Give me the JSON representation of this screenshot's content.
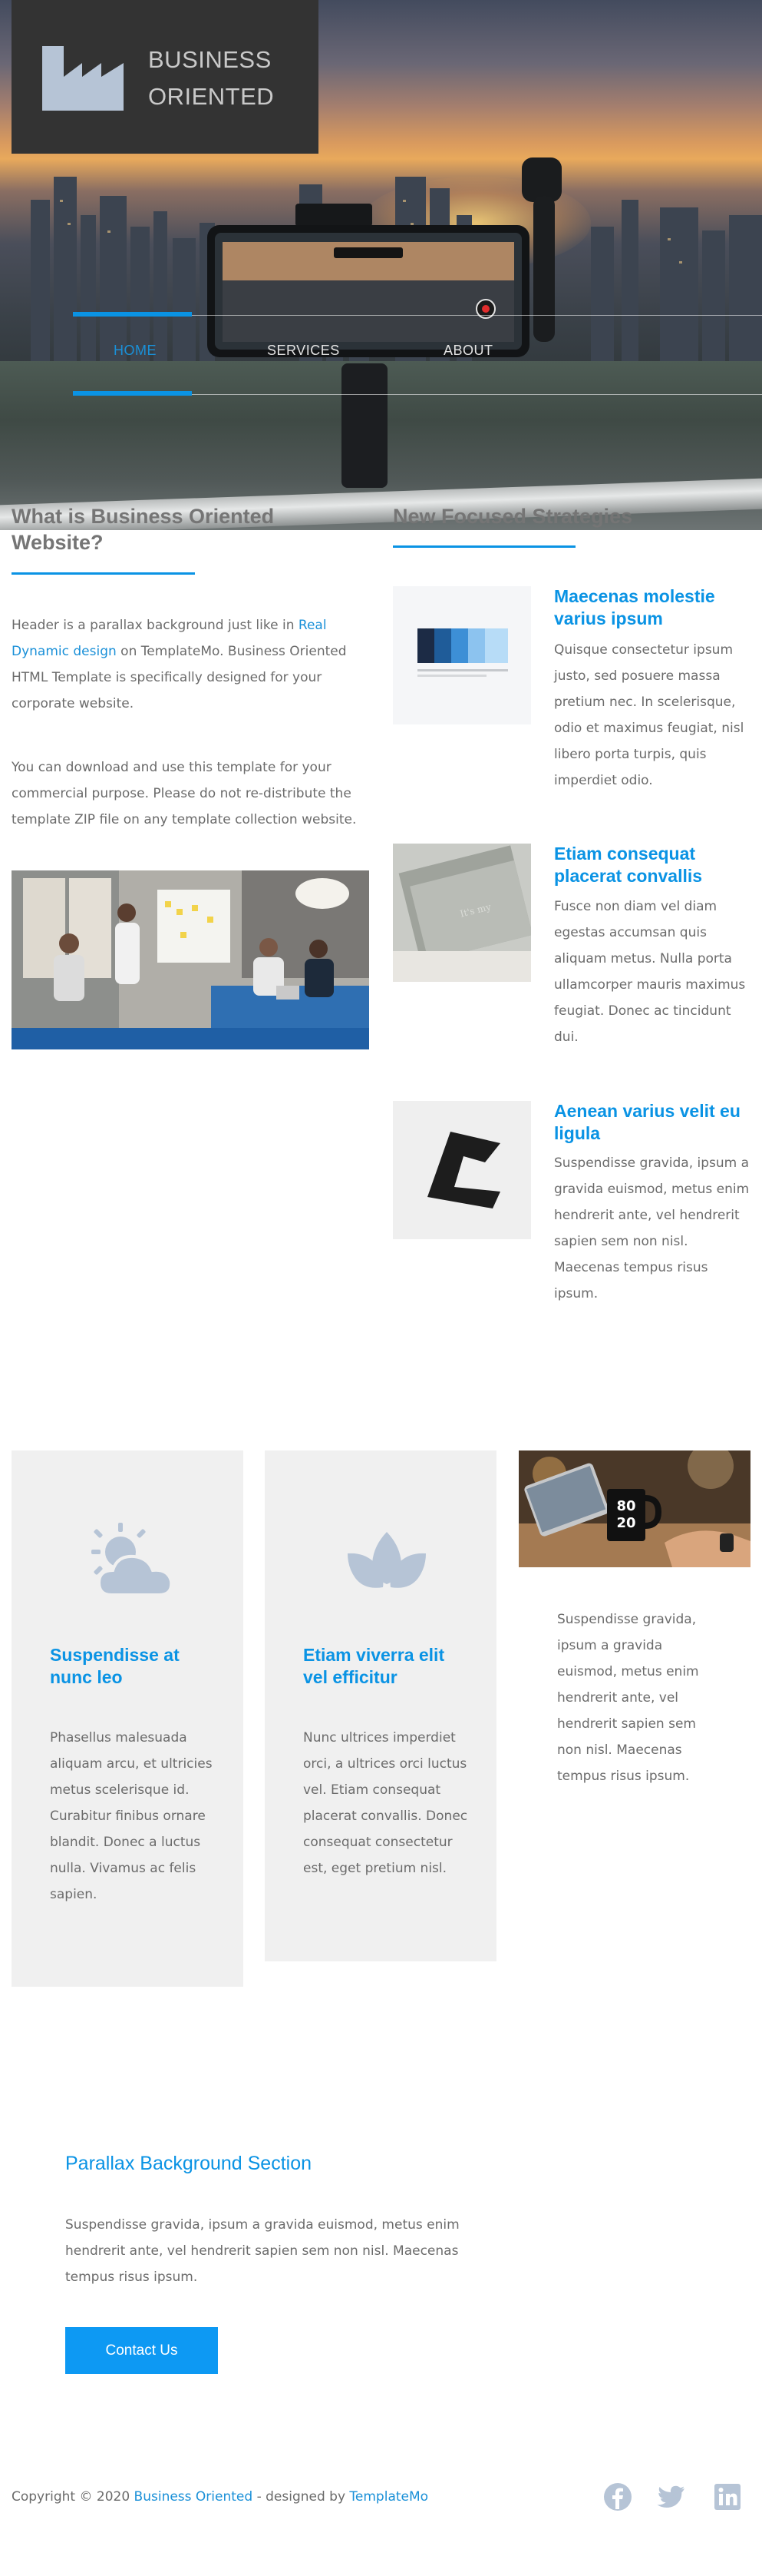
{
  "brand": {
    "name_line1": "BUSINESS",
    "name_line2": "ORIENTED"
  },
  "nav": {
    "items": [
      {
        "label": "HOME"
      },
      {
        "label": "SERVICES"
      },
      {
        "label": "ABOUT"
      }
    ]
  },
  "about": {
    "title": "What is Business Oriented Website?",
    "para1_before": "Header is a parallax background just like in ",
    "para1_link": "Real Dynamic design",
    "para1_after": " on TemplateMo. Business Oriented HTML Template is specifically designed for your corporate website.",
    "para2": "You can download and use this template for your commercial purpose. Please do not re-distribute the template ZIP file on any template collection website."
  },
  "strategies": {
    "title": "New Focused Strategies",
    "items": [
      {
        "title": "Maecenas molestie varius ipsum",
        "text": "Quisque consectetur ipsum justo, sed posuere massa pretium nec. In scelerisque, odio et maximus feugiat, nisl libero porta turpis, quis imperdiet odio."
      },
      {
        "title": "Etiam consequat placerat convallis",
        "text": "Fusce non diam vel diam egestas accumsan quis aliquam metus. Nulla porta ullamcorper mauris maximus feugiat. Donec ac tincidunt dui."
      },
      {
        "title": "Aenean varius velit eu ligula",
        "text": "Suspendisse gravida, ipsum a gravida euismod, metus enim hendrerit ante, vel hendrerit sapien sem non nisl. Maecenas tempus risus ipsum."
      }
    ],
    "thumb_text": "It's my"
  },
  "features": {
    "cards": [
      {
        "icon": "sun-cloud-icon",
        "title": "Suspendisse at nunc leo",
        "text": "Phasellus malesuada aliquam arcu, et ultricies metus scelerisque id. Curabitur finibus ornare blandit. Donec a luctus nulla. Vivamus ac felis sapien."
      },
      {
        "icon": "lotus-icon",
        "title": "Etiam viverra elit vel efficitur",
        "text": "Nunc ultrices imperdiet orci, a ultrices orci luctus vel. Etiam consequat placerat convallis. Donec consequat consectetur est, eget pretium nisl."
      }
    ],
    "mug_text_1": "80",
    "mug_text_2": "20",
    "side_text": "Suspendisse gravida, ipsum a gravida euismod, metus enim hendrerit ante, vel hendrerit sapien sem non nisl. Maecenas tempus risus ipsum."
  },
  "parallax": {
    "title": "Parallax Background Section",
    "text": "Suspendisse gravida, ipsum a gravida euismod, metus enim hendrerit ante, vel hendrerit sapien sem non nisl. Maecenas tempus risus ipsum.",
    "button": "Contact Us"
  },
  "footer": {
    "copyright": "Copyright © 2020 ",
    "brand_link": "Business Oriented",
    "designed_by": " - designed by ",
    "designer_link": "TemplateMo",
    "social": [
      "facebook-icon",
      "twitter-icon",
      "linkedin-icon"
    ]
  },
  "colors": {
    "accent": "#0a93e4",
    "button": "#0d99f3",
    "logo_bg": "#333333",
    "card_bg": "#f0f0f0",
    "icon": "#b6c4d6"
  }
}
